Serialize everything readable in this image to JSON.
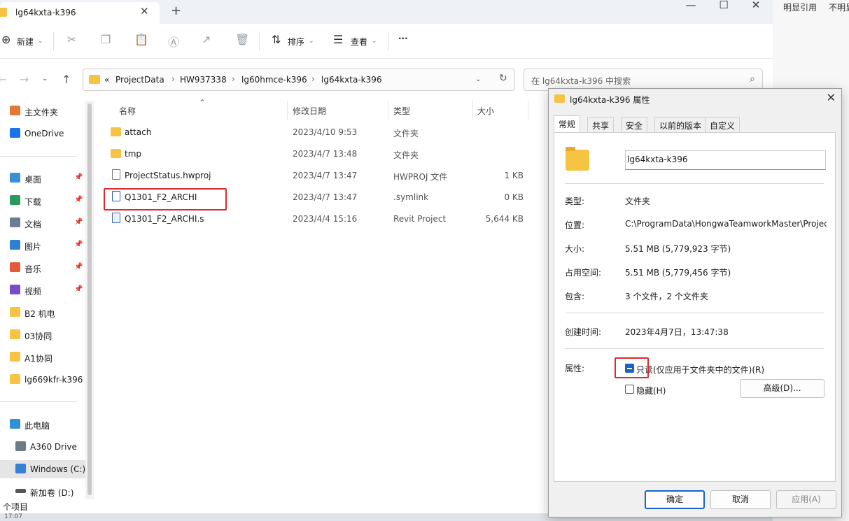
{
  "window": {
    "tab_title": "lg64kxta-k396",
    "close_glyph": "✕",
    "new_tab_glyph": "+",
    "minimize_glyph": "—",
    "maximize_glyph": "☐",
    "win_close_glyph": "✕"
  },
  "toolbar": {
    "new_label": "新建",
    "sort_label": "排序",
    "view_label": "查看",
    "more_label": "···"
  },
  "address": {
    "overflow": "«",
    "crumbs": [
      "ProjectData",
      "HW937338",
      "lg60hmce-k396",
      "lg64kxta-k396"
    ],
    "search_placeholder": "在 lg64kxta-k396 中搜索"
  },
  "sidebar": {
    "items": [
      {
        "label": "主文件夹",
        "color": "#e07a3a"
      },
      {
        "label": "OneDrive",
        "color": "#1a73e8"
      },
      {
        "label": "桌面",
        "color": "#3b8fd6",
        "pin": "📌"
      },
      {
        "label": "下载",
        "color": "#2a9a5a",
        "pin": "📌"
      },
      {
        "label": "文档",
        "color": "#6a7d95",
        "pin": "📌"
      },
      {
        "label": "图片",
        "color": "#2f7fd1",
        "pin": "📌"
      },
      {
        "label": "音乐",
        "color": "#e25b3c",
        "pin": "📌"
      },
      {
        "label": "视频",
        "color": "#7a4bc6",
        "pin": "📌"
      },
      {
        "label": "B2 机电",
        "color": "#f6c343"
      },
      {
        "label": "03协同",
        "color": "#f6c343"
      },
      {
        "label": "A1协同",
        "color": "#f6c343"
      },
      {
        "label": "lg669kfr-k396",
        "color": "#f6c343"
      },
      {
        "label": "此电脑",
        "color": "#2f8fd8"
      },
      {
        "label": "A360 Drive",
        "color": "#6d7a88"
      },
      {
        "label": "Windows (C:)",
        "color": "#3a7fd6"
      },
      {
        "label": "新加卷 (D:)",
        "color": "#555555"
      }
    ]
  },
  "filelist": {
    "headers": {
      "name": "名称",
      "date": "修改日期",
      "type": "类型",
      "size": "大小"
    },
    "rows": [
      {
        "name": "attach",
        "date": "2023/4/10 9:53",
        "type": "文件夹",
        "size": "",
        "kind": "folder"
      },
      {
        "name": "tmp",
        "date": "2023/4/7 13:48",
        "type": "文件夹",
        "size": "",
        "kind": "folder"
      },
      {
        "name": "ProjectStatus.hwproj",
        "date": "2023/4/7 13:47",
        "type": "HWPROJ 文件",
        "size": "1 KB",
        "kind": "doc"
      },
      {
        "name": "Q1301_F2_ARCHI",
        "date": "2023/4/7 13:47",
        "type": ".symlink",
        "size": "0 KB",
        "kind": "link"
      },
      {
        "name": "Q1301_F2_ARCHI.s",
        "date": "2023/4/4 15:16",
        "type": "Revit Project",
        "size": "5,644 KB",
        "kind": "revit"
      }
    ]
  },
  "status": {
    "count": "个项目",
    "time": "17:07"
  },
  "right_strip": {
    "a": "明显引用",
    "b": "不明显"
  },
  "dialog": {
    "title": "lg64kxta-k396 属性",
    "close_glyph": "✕",
    "tabs": [
      "常规",
      "共享",
      "安全",
      "以前的版本",
      "自定义"
    ],
    "folder_name": "lg64kxta-k396",
    "labels": {
      "type": "类型:",
      "location": "位置:",
      "size": "大小:",
      "disk": "占用空间:",
      "contains": "包含:",
      "created": "创建时间:",
      "attrs": "属性:"
    },
    "values": {
      "type": "文件夹",
      "location": "C:\\ProgramData\\HongwaTeamworkMaster\\ProjectData",
      "size": "5.51 MB (5,779,923 字节)",
      "disk": "5.51 MB (5,779,456 字节)",
      "contains": "3 个文件，2 个文件夹",
      "created": "2023年4月7日，13:47:38"
    },
    "readonly_label": "只读(仅应用于文件夹中的文件)(R)",
    "hidden_label": "隐藏(H)",
    "advanced_label": "高级(D)...",
    "ok_label": "确定",
    "cancel_label": "取消",
    "apply_label": "应用(A)"
  }
}
